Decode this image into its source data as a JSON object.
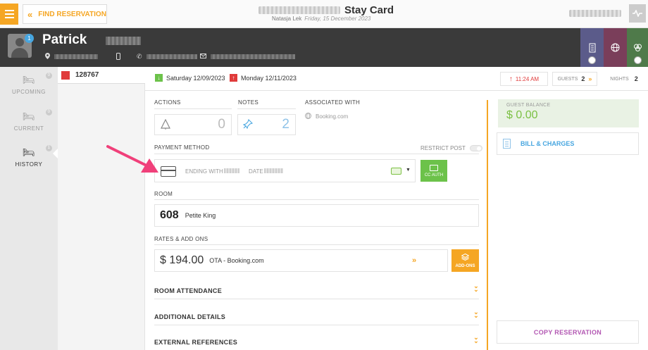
{
  "topbar": {
    "find_reservation": "FIND RESERVATION",
    "title": "Stay Card",
    "user": "Natasja Lek",
    "date": "Friday, 15 December 2023"
  },
  "guest": {
    "name": "Patrick",
    "badge": "1"
  },
  "sidebar": {
    "items": [
      {
        "label": "UPCOMING",
        "count": "0"
      },
      {
        "label": "CURRENT",
        "count": "0"
      },
      {
        "label": "HISTORY",
        "count": "1"
      }
    ]
  },
  "reservation": {
    "number": "128767",
    "arrival": "Saturday 12/09/2023",
    "departure": "Monday 12/11/2023",
    "time": "11:24 AM",
    "guests_label": "GUESTS",
    "guests": "2",
    "nights_label": "NIGHTS",
    "nights": "2"
  },
  "main": {
    "actions_label": "ACTIONS",
    "actions_count": "0",
    "notes_label": "NOTES",
    "notes_count": "2",
    "associated_label": "ASSOCIATED WITH",
    "associated_value": "Booking.com",
    "payment_label": "PAYMENT METHOD",
    "restrict_post": "RESTRICT POST",
    "ending_with": "ENDING WITH",
    "date_label": "DATE",
    "cc_auth": "CC AUTH",
    "room_label": "ROOM",
    "room_number": "608",
    "room_type": "Petite King",
    "rates_label": "RATES & ADD ONS",
    "rate_amount": "$ 194.00",
    "rate_plan": "OTA - Booking.com",
    "add_ons": "ADD-ONS",
    "room_attendance": "ROOM ATTENDANCE",
    "additional_details": "ADDITIONAL DETAILS",
    "external_references": "EXTERNAL REFERENCES"
  },
  "right": {
    "balance_label": "GUEST BALANCE",
    "balance_value": "$ 0.00",
    "bill_charges": "BILL & CHARGES",
    "copy_reservation": "COPY RESERVATION"
  },
  "colors": {
    "accent": "#f5a623",
    "header": "#3a3a3a",
    "green": "#6cc24a",
    "red": "#e03b3b",
    "blue": "#47a6e0",
    "purple": "#b256b2",
    "annotation_arrow": "#f0407a"
  },
  "icons": [
    "menu-icon",
    "double-chevron-left-icon",
    "activity-icon",
    "location-icon",
    "phone-icon",
    "mobile-icon",
    "email-icon",
    "credit-card-icon",
    "bell-icon",
    "pin-icon",
    "globe-icon",
    "building-icon",
    "bed-icon"
  ]
}
